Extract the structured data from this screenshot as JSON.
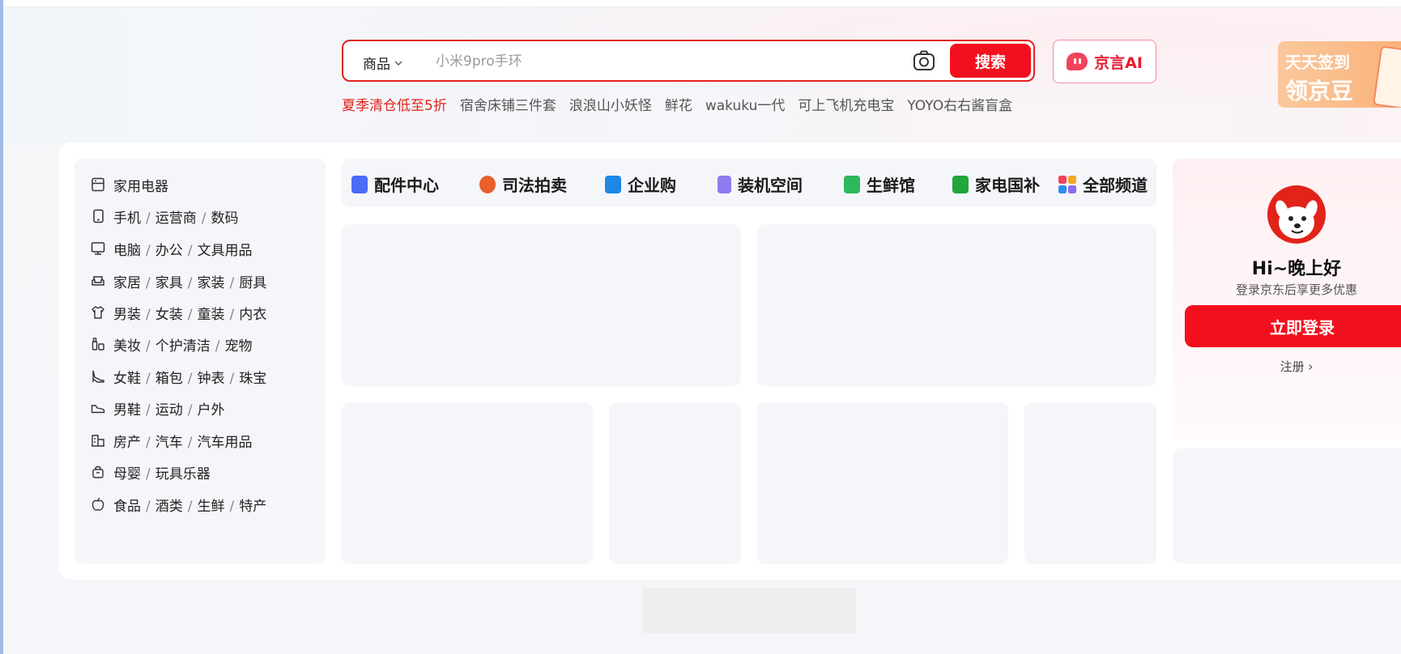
{
  "search": {
    "category_label": "商品",
    "placeholder": "小米9pro手环",
    "button_label": "搜索"
  },
  "ai_button": {
    "label": "京言AI"
  },
  "promo": {
    "line1": "天天签到",
    "line2": "领京豆"
  },
  "hotwords": [
    {
      "label": "夏季清仓低至5折",
      "highlight": true
    },
    {
      "label": "宿舍床铺三件套"
    },
    {
      "label": "浪浪山小妖怪"
    },
    {
      "label": "鲜花"
    },
    {
      "label": "wakuku一代"
    },
    {
      "label": "可上飞机充电宝"
    },
    {
      "label": "YOYO右右酱盲盒"
    }
  ],
  "categories": [
    {
      "icon": "appliance-icon",
      "parts": [
        "家用电器"
      ]
    },
    {
      "icon": "phone-icon",
      "parts": [
        "手机",
        "运营商",
        "数码"
      ]
    },
    {
      "icon": "monitor-icon",
      "parts": [
        "电脑",
        "办公",
        "文具用品"
      ]
    },
    {
      "icon": "sofa-icon",
      "parts": [
        "家居",
        "家具",
        "家装",
        "厨具"
      ]
    },
    {
      "icon": "shirt-icon",
      "parts": [
        "男装",
        "女装",
        "童装",
        "内衣"
      ]
    },
    {
      "icon": "cosmetics-icon",
      "parts": [
        "美妆",
        "个护清洁",
        "宠物"
      ]
    },
    {
      "icon": "heel-icon",
      "parts": [
        "女鞋",
        "箱包",
        "钟表",
        "珠宝"
      ]
    },
    {
      "icon": "sneaker-icon",
      "parts": [
        "男鞋",
        "运动",
        "户外"
      ]
    },
    {
      "icon": "building-icon",
      "parts": [
        "房产",
        "汽车",
        "汽车用品"
      ]
    },
    {
      "icon": "baby-bag-icon",
      "parts": [
        "母婴",
        "玩具乐器"
      ]
    },
    {
      "icon": "apple-icon",
      "parts": [
        "食品",
        "酒类",
        "生鲜",
        "特产"
      ]
    }
  ],
  "channels": [
    {
      "label": "配件中心",
      "icon": "accessory-center-icon",
      "color": "#4a6cf7"
    },
    {
      "label": "司法拍卖",
      "icon": "auction-icon",
      "color": "#e8602c"
    },
    {
      "label": "企业购",
      "icon": "enterprise-icon",
      "color": "#1e88e5"
    },
    {
      "label": "装机空间",
      "icon": "diy-pc-icon",
      "color": "#8c7cf0"
    },
    {
      "label": "生鲜馆",
      "icon": "fresh-basket-icon",
      "color": "#2fb85a"
    },
    {
      "label": "家电国补",
      "icon": "appliance-subsidy-icon",
      "color": "#22a53c"
    },
    {
      "label": "全部频道",
      "icon": "all-channels-icon",
      "color": "#f0435a"
    }
  ],
  "user": {
    "greeting": "Hi~晚上好",
    "subtitle": "登录京东后享更多优惠",
    "login_label": "立即登录",
    "register_label": "注册 ›"
  },
  "colors": {
    "brand_red": "#f3101e",
    "border_red": "#e2231a"
  }
}
